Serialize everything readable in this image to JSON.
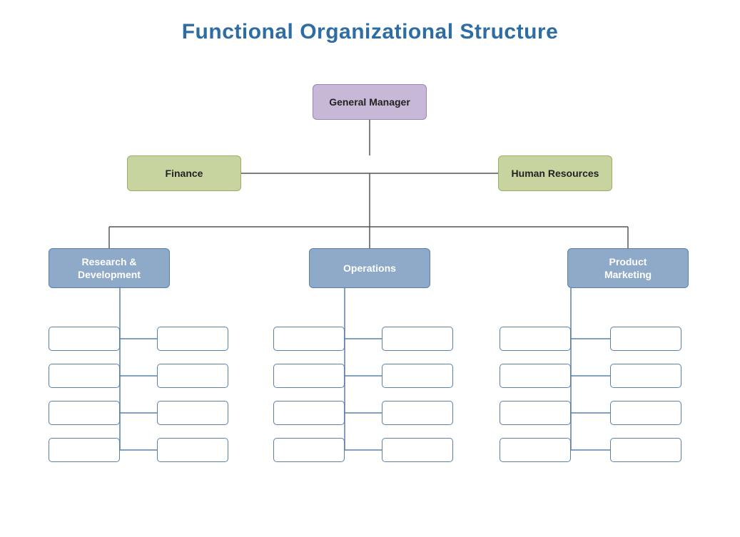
{
  "title": "Functional Organizational Structure",
  "nodes": {
    "gm": "General Manager",
    "finance": "Finance",
    "hr": "Human Resources",
    "rd": "Research &\nDevelopment",
    "ops": "Operations",
    "pm": "Product\nMarketing"
  }
}
